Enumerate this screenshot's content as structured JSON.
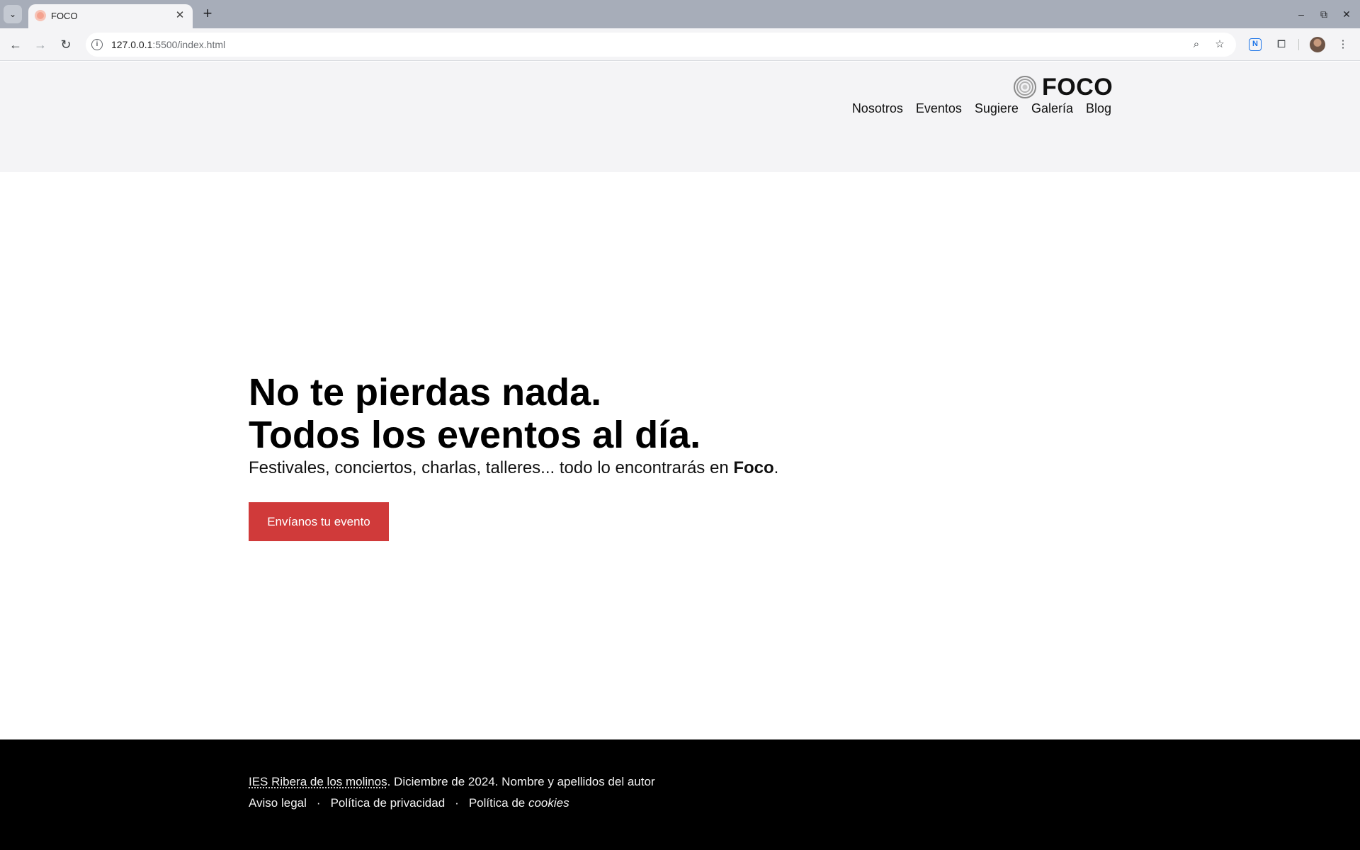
{
  "browser": {
    "tab_title": "FOCO",
    "tab_close": "✕",
    "new_tab": "+",
    "url_host": "127.0.0.1",
    "url_rest": ":5500/index.html",
    "ext_label": "N",
    "icons": [
      "tab-search-icon",
      "close-icon",
      "plus-icon",
      "back-icon",
      "forward-icon",
      "reload-icon",
      "info-icon",
      "zoom-icon",
      "star-icon",
      "extension-icon",
      "puzzle-icon",
      "avatar",
      "kebab-menu-icon",
      "minimize-icon",
      "restore-icon",
      "window-close-icon"
    ]
  },
  "header": {
    "brand": "FOCO",
    "nav": [
      "Nosotros",
      "Eventos",
      "Sugiere",
      "Galería",
      "Blog"
    ]
  },
  "hero": {
    "title_line1": "No te pierdas nada.",
    "title_line2": "Todos los eventos al día.",
    "subtitle_prefix": "Festivales, conciertos, charlas, talleres... todo lo encontrarás en ",
    "subtitle_brand": "Foco",
    "subtitle_suffix": ".",
    "cta": "Envíanos tu evento"
  },
  "footer": {
    "institution": "IES Ribera de los molinos",
    "credits": ". Diciembre de 2024. Nombre y apellidos del autor",
    "links": {
      "legal": "Aviso legal",
      "privacy": "Política de privacidad",
      "cookies_prefix": "Política de ",
      "cookies_em": "cookies"
    },
    "separator": "·"
  },
  "colors": {
    "chrome": "#a7adb9",
    "header_bg": "#f4f4f6",
    "accent": "#d03a3a",
    "footer_bg": "#000000"
  }
}
